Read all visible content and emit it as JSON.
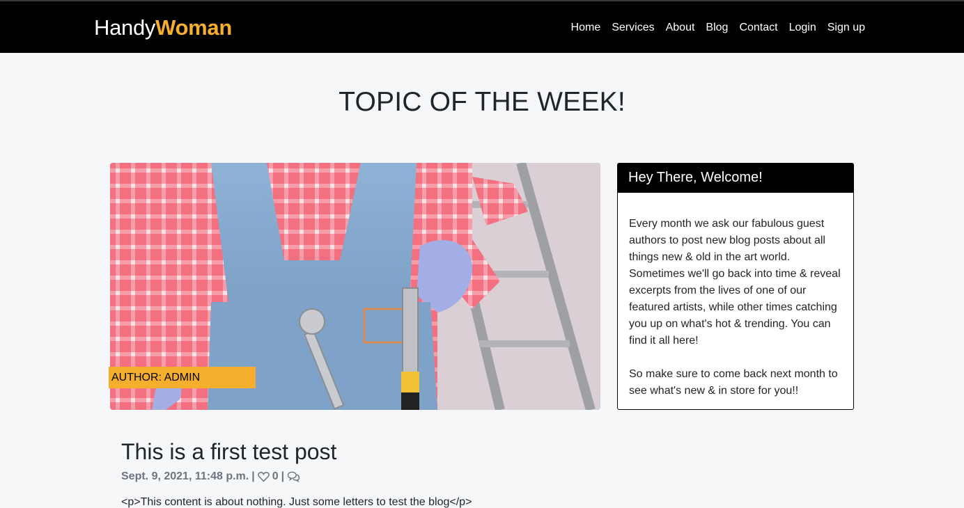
{
  "navbar": {
    "brand_part1": "Handy",
    "brand_part2": "Woman",
    "links": [
      "Home",
      "Services",
      "About",
      "Blog",
      "Contact",
      "Login",
      "Sign up"
    ]
  },
  "page_title": "TOPIC OF THE WEEK!",
  "hero": {
    "image_description_icon": "handywoman-photo",
    "author_label": "AUTHOR: ADMIN"
  },
  "welcome_card": {
    "title": "Hey There, Welcome!",
    "paragraph1": "Every month we ask our fabulous guest authors to post new blog posts about all things new & old in the art world. Sometimes we'll go back into time & reveal excerpts from the lives of one of our featured artists, while other times catching you up on what's hot & trending. You can find it all here!",
    "paragraph2": "So make sure to come back next month to see what's new & in store for you!!"
  },
  "post": {
    "title": "This is a first test post",
    "date": "Sept. 9, 2021, 11:48 p.m.",
    "separator": "|",
    "likes": "0",
    "content": "<p>This content is about nothing. Just some letters to test the blog</p>"
  },
  "colors": {
    "accent": "#f6ae2d",
    "navbar_bg": "#000000",
    "page_bg": "#f6f7f9"
  }
}
